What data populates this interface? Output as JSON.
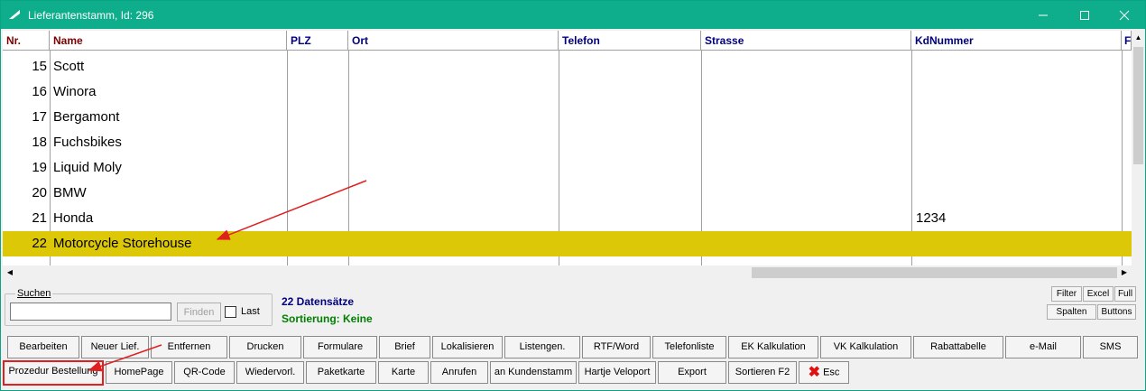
{
  "window": {
    "title": "Lieferantenstamm, Id: 296"
  },
  "columns": [
    "Nr.",
    "Name",
    "PLZ",
    "Ort",
    "Telefon",
    "Strasse",
    "KdNummer",
    "F"
  ],
  "rows": [
    {
      "nr": "15",
      "name": "Scott",
      "kd": ""
    },
    {
      "nr": "16",
      "name": "Winora",
      "kd": ""
    },
    {
      "nr": "17",
      "name": "Bergamont",
      "kd": ""
    },
    {
      "nr": "18",
      "name": "Fuchsbikes",
      "kd": ""
    },
    {
      "nr": "19",
      "name": "Liquid Moly",
      "kd": ""
    },
    {
      "nr": "20",
      "name": "BMW",
      "kd": ""
    },
    {
      "nr": "21",
      "name": "Honda",
      "kd": "1234"
    },
    {
      "nr": "22",
      "name": "Motorcycle Storehouse",
      "kd": ""
    }
  ],
  "selected_row": "22",
  "search": {
    "legend": "Suchen",
    "value": "",
    "find_label": "Finden",
    "last_label": "Last",
    "last_checked": false
  },
  "status": {
    "count": "22 Datensätze",
    "sorting": "Sortierung: Keine"
  },
  "small_buttons": {
    "filter": "Filter",
    "excel": "Excel",
    "full": "Full",
    "spalten": "Spalten",
    "buttons": "Buttons"
  },
  "toolbar_row1": [
    "Bearbeiten",
    "Neuer Lief.",
    "Entfernen",
    "Drucken",
    "Formulare",
    "Brief",
    "Lokalisieren",
    "Listengen.",
    "RTF/Word",
    "Telefonliste",
    "EK Kalkulation",
    "VK Kalkulation",
    "Rabattabelle",
    "e-Mail",
    "SMS"
  ],
  "toolbar_row2": [
    "Prozedur Bestellung",
    "HomePage",
    "QR-Code",
    "Wiedervorl.",
    "Paketkarte",
    "Karte",
    "Anrufen",
    "an Kundenstamm",
    "Hartje Veloport",
    "Export",
    "Sortieren F2",
    "Esc"
  ],
  "colors": {
    "titlebar": "#0ead8c",
    "selection": "#dcc806",
    "annotation": "#e02020"
  }
}
